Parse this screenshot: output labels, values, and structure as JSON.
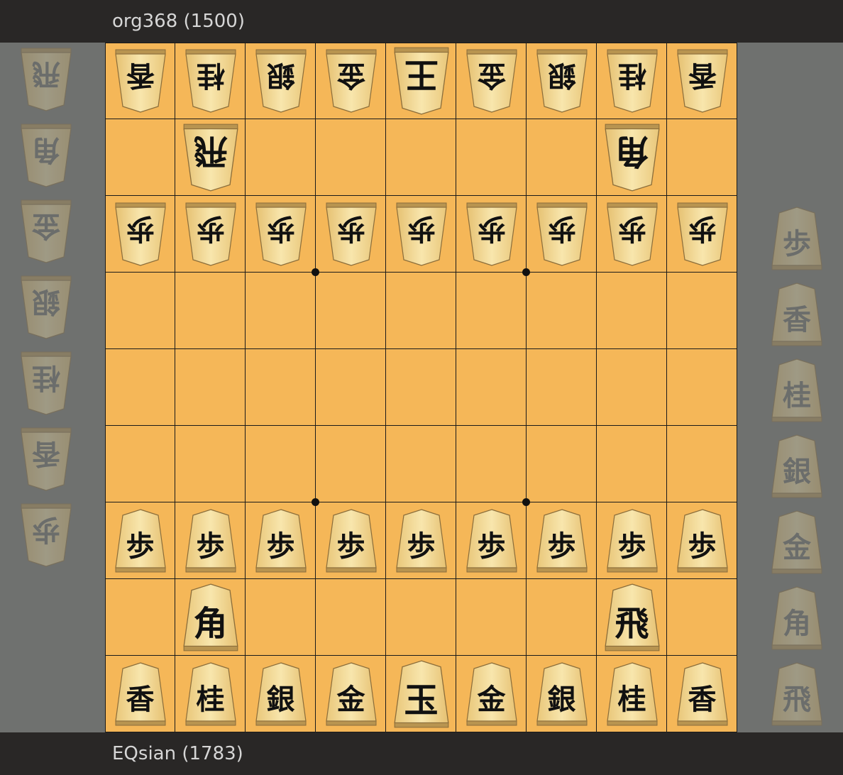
{
  "players": {
    "top": "org368 (1500)",
    "bottom": "EQsian (1783)"
  },
  "colors": {
    "board": "#f5b758",
    "bar": "#292726",
    "background": "#6f716f",
    "piece_face": "#f4dc98",
    "ink": "#111111"
  },
  "board": {
    "files": 9,
    "ranks": 9,
    "star_points": [
      [
        3,
        3
      ],
      [
        3,
        6
      ],
      [
        6,
        3
      ],
      [
        6,
        6
      ]
    ],
    "pieces": [
      {
        "file": 0,
        "rank": 0,
        "char": "香",
        "side": "gote"
      },
      {
        "file": 1,
        "rank": 0,
        "char": "桂",
        "side": "gote"
      },
      {
        "file": 2,
        "rank": 0,
        "char": "銀",
        "side": "gote"
      },
      {
        "file": 3,
        "rank": 0,
        "char": "金",
        "side": "gote"
      },
      {
        "file": 4,
        "rank": 0,
        "char": "王",
        "side": "gote",
        "big": true
      },
      {
        "file": 5,
        "rank": 0,
        "char": "金",
        "side": "gote"
      },
      {
        "file": 6,
        "rank": 0,
        "char": "銀",
        "side": "gote"
      },
      {
        "file": 7,
        "rank": 0,
        "char": "桂",
        "side": "gote"
      },
      {
        "file": 8,
        "rank": 0,
        "char": "香",
        "side": "gote"
      },
      {
        "file": 1,
        "rank": 1,
        "char": "飛",
        "side": "gote",
        "big": true
      },
      {
        "file": 7,
        "rank": 1,
        "char": "角",
        "side": "gote",
        "big": true
      },
      {
        "file": 0,
        "rank": 2,
        "char": "歩",
        "side": "gote"
      },
      {
        "file": 1,
        "rank": 2,
        "char": "歩",
        "side": "gote"
      },
      {
        "file": 2,
        "rank": 2,
        "char": "歩",
        "side": "gote"
      },
      {
        "file": 3,
        "rank": 2,
        "char": "歩",
        "side": "gote"
      },
      {
        "file": 4,
        "rank": 2,
        "char": "歩",
        "side": "gote"
      },
      {
        "file": 5,
        "rank": 2,
        "char": "歩",
        "side": "gote"
      },
      {
        "file": 6,
        "rank": 2,
        "char": "歩",
        "side": "gote"
      },
      {
        "file": 7,
        "rank": 2,
        "char": "歩",
        "side": "gote"
      },
      {
        "file": 8,
        "rank": 2,
        "char": "歩",
        "side": "gote"
      },
      {
        "file": 0,
        "rank": 6,
        "char": "歩",
        "side": "sente"
      },
      {
        "file": 1,
        "rank": 6,
        "char": "歩",
        "side": "sente"
      },
      {
        "file": 2,
        "rank": 6,
        "char": "歩",
        "side": "sente"
      },
      {
        "file": 3,
        "rank": 6,
        "char": "歩",
        "side": "sente"
      },
      {
        "file": 4,
        "rank": 6,
        "char": "歩",
        "side": "sente"
      },
      {
        "file": 5,
        "rank": 6,
        "char": "歩",
        "side": "sente"
      },
      {
        "file": 6,
        "rank": 6,
        "char": "歩",
        "side": "sente"
      },
      {
        "file": 7,
        "rank": 6,
        "char": "歩",
        "side": "sente"
      },
      {
        "file": 8,
        "rank": 6,
        "char": "歩",
        "side": "sente"
      },
      {
        "file": 1,
        "rank": 7,
        "char": "角",
        "side": "sente",
        "big": true
      },
      {
        "file": 7,
        "rank": 7,
        "char": "飛",
        "side": "sente",
        "big": true
      },
      {
        "file": 0,
        "rank": 8,
        "char": "香",
        "side": "sente"
      },
      {
        "file": 1,
        "rank": 8,
        "char": "桂",
        "side": "sente"
      },
      {
        "file": 2,
        "rank": 8,
        "char": "銀",
        "side": "sente"
      },
      {
        "file": 3,
        "rank": 8,
        "char": "金",
        "side": "sente"
      },
      {
        "file": 4,
        "rank": 8,
        "char": "玉",
        "side": "sente",
        "big": true
      },
      {
        "file": 5,
        "rank": 8,
        "char": "金",
        "side": "sente"
      },
      {
        "file": 6,
        "rank": 8,
        "char": "銀",
        "side": "sente"
      },
      {
        "file": 7,
        "rank": 8,
        "char": "桂",
        "side": "sente"
      },
      {
        "file": 8,
        "rank": 8,
        "char": "香",
        "side": "sente"
      }
    ]
  },
  "hands": {
    "top": [
      "飛",
      "角",
      "金",
      "銀",
      "桂",
      "香",
      "歩"
    ],
    "bottom": [
      "歩",
      "香",
      "桂",
      "銀",
      "金",
      "角",
      "飛"
    ]
  }
}
